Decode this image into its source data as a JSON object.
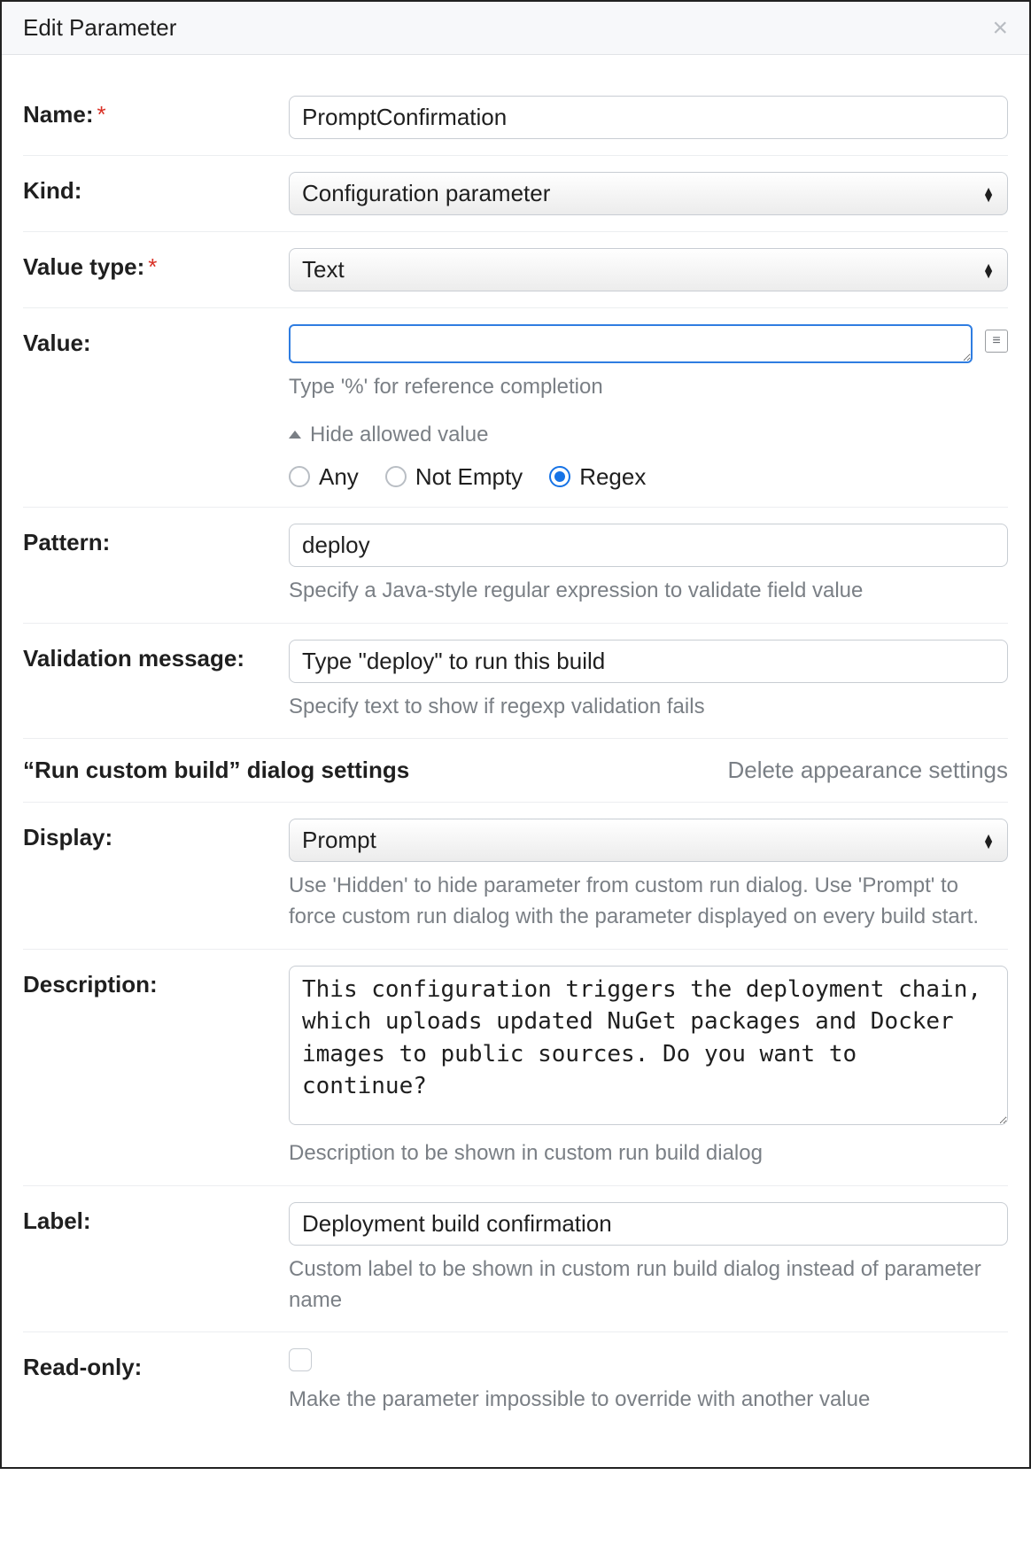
{
  "dialog": {
    "title": "Edit Parameter"
  },
  "fields": {
    "name": {
      "label": "Name:",
      "value": "PromptConfirmation"
    },
    "kind": {
      "label": "Kind:",
      "value": "Configuration parameter"
    },
    "value_type": {
      "label": "Value type:",
      "value": "Text"
    },
    "value": {
      "label": "Value:",
      "value": "",
      "hint": "Type '%' for reference completion",
      "toggle": "Hide allowed value",
      "radios": {
        "any": "Any",
        "not_empty": "Not Empty",
        "regex": "Regex"
      }
    },
    "pattern": {
      "label": "Pattern:",
      "value": "deploy",
      "hint": "Specify a Java-style regular expression to validate field value"
    },
    "validation_message": {
      "label": "Validation message:",
      "value": "Type \"deploy\" to run this build",
      "hint": "Specify text to show if regexp validation fails"
    },
    "display": {
      "label": "Display:",
      "value": "Prompt",
      "hint": "Use 'Hidden' to hide parameter from custom run dialog. Use 'Prompt' to force custom run dialog with the parameter displayed on every build start."
    },
    "description": {
      "label": "Description:",
      "value": "This configuration triggers the deployment chain, which uploads updated NuGet packages and Docker images to public sources. Do you want to continue?",
      "hint": "Description to be shown in custom run build dialog"
    },
    "label_field": {
      "label": "Label:",
      "value": "Deployment build confirmation",
      "hint": "Custom label to be shown in custom run build dialog instead of parameter name"
    },
    "read_only": {
      "label": "Read-only:",
      "hint": "Make the parameter impossible to override with another value"
    }
  },
  "section": {
    "title": "“Run custom build” dialog settings",
    "link": "Delete appearance settings"
  }
}
